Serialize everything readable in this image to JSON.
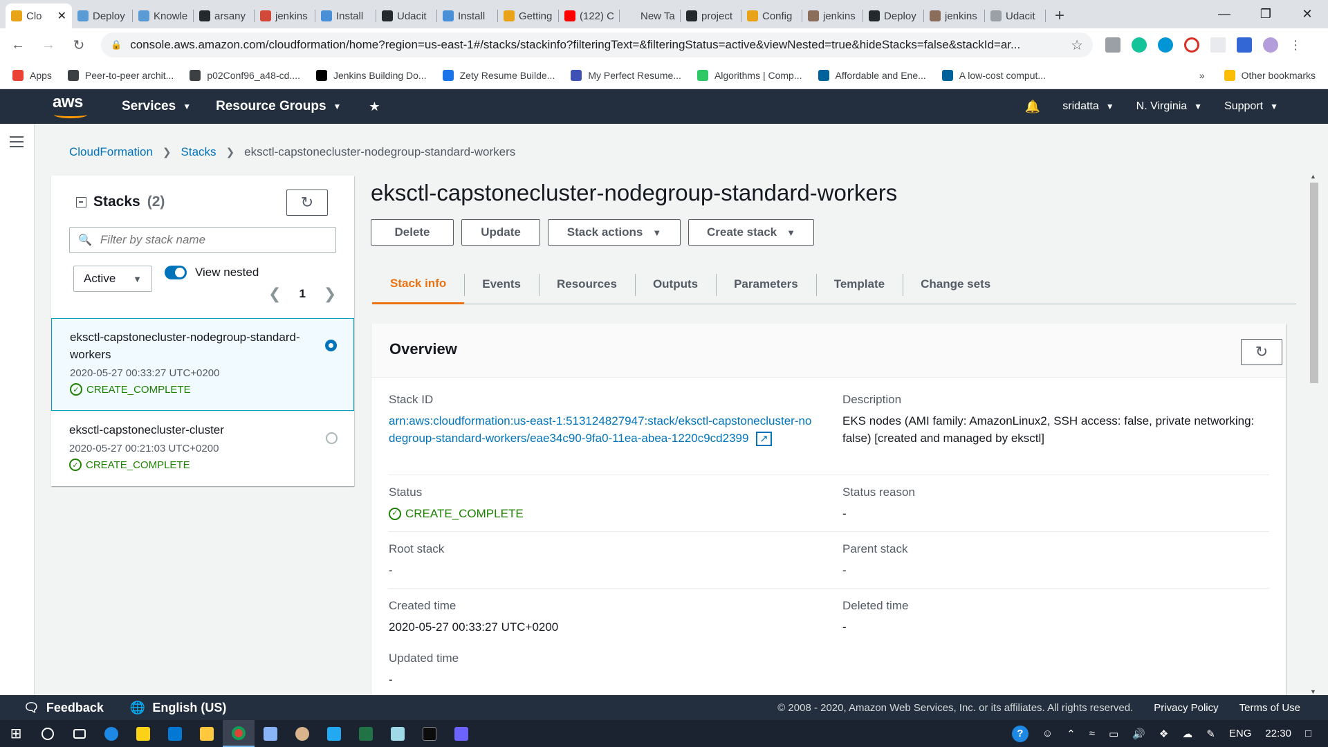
{
  "browser": {
    "tabs": [
      {
        "title": "Clo",
        "color": "#e8a317"
      },
      {
        "title": "Deploy",
        "color": "#5b9bd5"
      },
      {
        "title": "Knowle",
        "color": "#5b9bd5"
      },
      {
        "title": "arsany",
        "color": "#24292e"
      },
      {
        "title": "jenkins",
        "color": "#d24939"
      },
      {
        "title": "Install",
        "color": "#4a90d9"
      },
      {
        "title": "Udacit",
        "color": "#24292e"
      },
      {
        "title": "Install",
        "color": "#4a90d9"
      },
      {
        "title": "Getting",
        "color": "#e8a317"
      },
      {
        "title": "(122) C",
        "color": "#ff0000"
      },
      {
        "title": "New Tab",
        "color": "#dee1e6"
      },
      {
        "title": "project",
        "color": "#24292e"
      },
      {
        "title": "Config",
        "color": "#e8a317"
      },
      {
        "title": "jenkins",
        "color": "#8b6d5c"
      },
      {
        "title": "Deploy",
        "color": "#24292e"
      },
      {
        "title": "jenkins",
        "color": "#8b6d5c"
      },
      {
        "title": "Udacit",
        "color": "#9aa0a6"
      }
    ],
    "url": "console.aws.amazon.com/cloudformation/home?region=us-east-1#/stacks/stackinfo?filteringText=&filteringStatus=active&viewNested=true&hideStacks=false&stackId=ar...",
    "bookmarks": [
      {
        "label": "Apps",
        "color": "#ea4335"
      },
      {
        "label": "Peer-to-peer archit...",
        "color": "#3c4043"
      },
      {
        "label": "p02Conf96_a48-cd....",
        "color": "#3c4043"
      },
      {
        "label": "Jenkins Building Do...",
        "color": "#000000"
      },
      {
        "label": "Zety Resume Builde...",
        "color": "#1a73e8"
      },
      {
        "label": "My Perfect Resume...",
        "color": "#3f51b5"
      },
      {
        "label": "Algorithms | Comp...",
        "color": "#2ec866"
      },
      {
        "label": "Affordable and Ene...",
        "color": "#00629b"
      },
      {
        "label": "A low-cost comput...",
        "color": "#00629b"
      }
    ],
    "bookmarks_more": "»",
    "other_bookmarks": "Other bookmarks"
  },
  "aws_nav": {
    "logo": "aws",
    "services": "Services",
    "resource_groups": "Resource Groups",
    "user": "sridatta",
    "region": "N. Virginia",
    "support": "Support"
  },
  "breadcrumb": {
    "root": "CloudFormation",
    "stacks": "Stacks",
    "current": "eksctl-capstonecluster-nodegroup-standard-workers"
  },
  "stacks_panel": {
    "title": "Stacks",
    "count": "(2)",
    "filter_placeholder": "Filter by stack name",
    "status_filter": "Active",
    "view_nested_label": "View nested",
    "page": "1",
    "items": [
      {
        "name": "eksctl-capstonecluster-nodegroup-standard-workers",
        "date": "2020-05-27 00:33:27 UTC+0200",
        "status": "CREATE_COMPLETE"
      },
      {
        "name": "eksctl-capstonecluster-cluster",
        "date": "2020-05-27 00:21:03 UTC+0200",
        "status": "CREATE_COMPLETE"
      }
    ]
  },
  "main": {
    "title": "eksctl-capstonecluster-nodegroup-standard-workers",
    "buttons": {
      "delete": "Delete",
      "update": "Update",
      "stack_actions": "Stack actions",
      "create_stack": "Create stack"
    },
    "tabs": [
      "Stack info",
      "Events",
      "Resources",
      "Outputs",
      "Parameters",
      "Template",
      "Change sets"
    ],
    "active_tab": "Stack info"
  },
  "overview": {
    "heading": "Overview",
    "stack_id_label": "Stack ID",
    "stack_id": "arn:aws:cloudformation:us-east-1:513124827947:stack/eksctl-capstonecluster-nodegroup-standard-workers/eae34c90-9fa0-11ea-abea-1220c9cd2399",
    "description_label": "Description",
    "description": "EKS nodes (AMI family: AmazonLinux2, SSH access: false, private networking: false) [created and managed by eksctl]",
    "status_label": "Status",
    "status": "CREATE_COMPLETE",
    "status_reason_label": "Status reason",
    "status_reason": "-",
    "root_stack_label": "Root stack",
    "root_stack": "-",
    "parent_stack_label": "Parent stack",
    "parent_stack": "-",
    "created_time_label": "Created time",
    "created_time": "2020-05-27 00:33:27 UTC+0200",
    "deleted_time_label": "Deleted time",
    "deleted_time": "-",
    "updated_time_label": "Updated time",
    "updated_time": "-"
  },
  "footer": {
    "feedback": "Feedback",
    "language": "English (US)",
    "copyright": "© 2008 - 2020, Amazon Web Services, Inc. or its affiliates. All rights reserved.",
    "privacy": "Privacy Policy",
    "terms": "Terms of Use"
  },
  "taskbar": {
    "lang": "ENG",
    "time": "22:30"
  },
  "colors": {
    "aws_nav": "#232f3e",
    "aws_orange": "#ec7211",
    "link": "#0073bb",
    "success": "#1d8102"
  }
}
